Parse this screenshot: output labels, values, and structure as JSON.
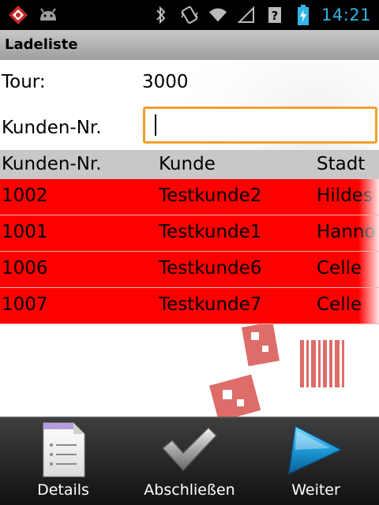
{
  "status_bar": {
    "time": "14:21",
    "icons": [
      "app-icon",
      "android-icon",
      "bluetooth-icon",
      "vibrate-icon",
      "wifi-icon",
      "signal-icon",
      "sim-unknown-icon",
      "battery-charging-icon"
    ]
  },
  "header": {
    "title": "Ladeliste"
  },
  "form": {
    "tour_label": "Tour:",
    "tour_value": "3000",
    "customer_label": "Kunden-Nr.",
    "customer_input_value": ""
  },
  "table": {
    "columns": [
      "Kunden-Nr.",
      "Kunde",
      "Stadt"
    ],
    "rows": [
      [
        "1002",
        "Testkunde2",
        "Hildes"
      ],
      [
        "1001",
        "Testkunde1",
        "Hanno"
      ],
      [
        "1006",
        "Testkunde6",
        "Celle"
      ],
      [
        "1007",
        "Testkunde7",
        "Celle"
      ]
    ],
    "row_color": "#ff0000"
  },
  "actions": [
    {
      "label": "Details",
      "icon": "document-list-icon"
    },
    {
      "label": "Abschließen",
      "icon": "checkmark-icon"
    },
    {
      "label": "Weiter",
      "icon": "play-arrow-icon"
    }
  ],
  "colors": {
    "accent": "#f0a030",
    "clock": "#33b5e5"
  }
}
